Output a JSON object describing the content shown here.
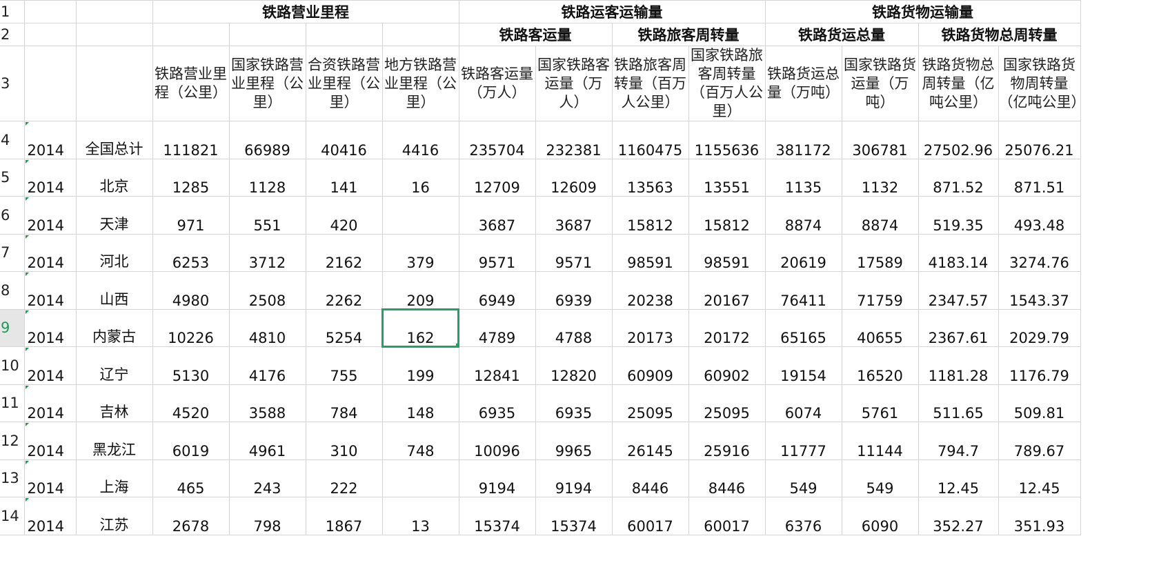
{
  "row_numbers": [
    "1",
    "2",
    "3",
    "4",
    "5",
    "6",
    "7",
    "8",
    "9",
    "10",
    "11",
    "12",
    "13",
    "14"
  ],
  "groups": {
    "mileage": "铁路营业里程",
    "passenger": "铁路运客运输量",
    "freight": "铁路货物运输量"
  },
  "subgroups": {
    "passenger_volume": "铁路客运量",
    "passenger_turnover": "铁路旅客周转量",
    "freight_volume": "铁路货运总量",
    "freight_turnover": "铁路货物总周转量"
  },
  "columns": [
    "铁路营业里程（公里）",
    "国家铁路营业里程（公里）",
    "合资铁路营业里程（公里）",
    "地方铁路营业里程（公里）",
    "铁路客运量（万人）",
    "国家铁路客运量（万人）",
    "铁路旅客周转量（百万人公里）",
    "国家铁路旅客周转量（百万人公里）",
    "铁路货运总量（万吨）",
    "国家铁路货运量（万吨）",
    "铁路货物总周转量（亿吨公里）",
    "国家铁路货物周转量（亿吨公里）"
  ],
  "rows": [
    {
      "year": "2014",
      "region": "全国总计",
      "values": [
        "111821",
        "66989",
        "40416",
        "4416",
        "235704",
        "232381",
        "1160475",
        "1155636",
        "381172",
        "306781",
        "27502.96",
        "25076.21"
      ]
    },
    {
      "year": "2014",
      "region": "北京",
      "values": [
        "1285",
        "1128",
        "141",
        "16",
        "12709",
        "12609",
        "13563",
        "13551",
        "1135",
        "1132",
        "871.52",
        "871.51"
      ]
    },
    {
      "year": "2014",
      "region": "天津",
      "values": [
        "971",
        "551",
        "420",
        "",
        "3687",
        "3687",
        "15812",
        "15812",
        "8874",
        "8874",
        "519.35",
        "493.48"
      ]
    },
    {
      "year": "2014",
      "region": "河北",
      "values": [
        "6253",
        "3712",
        "2162",
        "379",
        "9571",
        "9571",
        "98591",
        "98591",
        "20619",
        "17589",
        "4183.14",
        "3274.76"
      ]
    },
    {
      "year": "2014",
      "region": "山西",
      "values": [
        "4980",
        "2508",
        "2262",
        "209",
        "6949",
        "6939",
        "20238",
        "20167",
        "76411",
        "71759",
        "2347.57",
        "1543.37"
      ]
    },
    {
      "year": "2014",
      "region": "内蒙古",
      "values": [
        "10226",
        "4810",
        "5254",
        "162",
        "4789",
        "4788",
        "20173",
        "20172",
        "65165",
        "40655",
        "2367.61",
        "2029.79"
      ]
    },
    {
      "year": "2014",
      "region": "辽宁",
      "values": [
        "5130",
        "4176",
        "755",
        "199",
        "12841",
        "12820",
        "60909",
        "60902",
        "19154",
        "16520",
        "1181.28",
        "1176.79"
      ]
    },
    {
      "year": "2014",
      "region": "吉林",
      "values": [
        "4520",
        "3588",
        "784",
        "148",
        "6935",
        "6935",
        "25095",
        "25095",
        "6074",
        "5761",
        "511.65",
        "509.81"
      ]
    },
    {
      "year": "2014",
      "region": "黑龙江",
      "values": [
        "6019",
        "4961",
        "310",
        "748",
        "10096",
        "9965",
        "26145",
        "25916",
        "11777",
        "11144",
        "794.7",
        "789.67"
      ]
    },
    {
      "year": "2014",
      "region": "上海",
      "values": [
        "465",
        "243",
        "222",
        "",
        "9194",
        "9194",
        "8446",
        "8446",
        "549",
        "549",
        "12.45",
        "12.45"
      ]
    },
    {
      "year": "2014",
      "region": "江苏",
      "values": [
        "2678",
        "798",
        "1867",
        "13",
        "15374",
        "15374",
        "60017",
        "60017",
        "6376",
        "6090",
        "352.27",
        "351.93"
      ]
    }
  ],
  "selected_cell": {
    "row": "9",
    "column": "地方铁路营业里程（公里）",
    "value": "162"
  }
}
